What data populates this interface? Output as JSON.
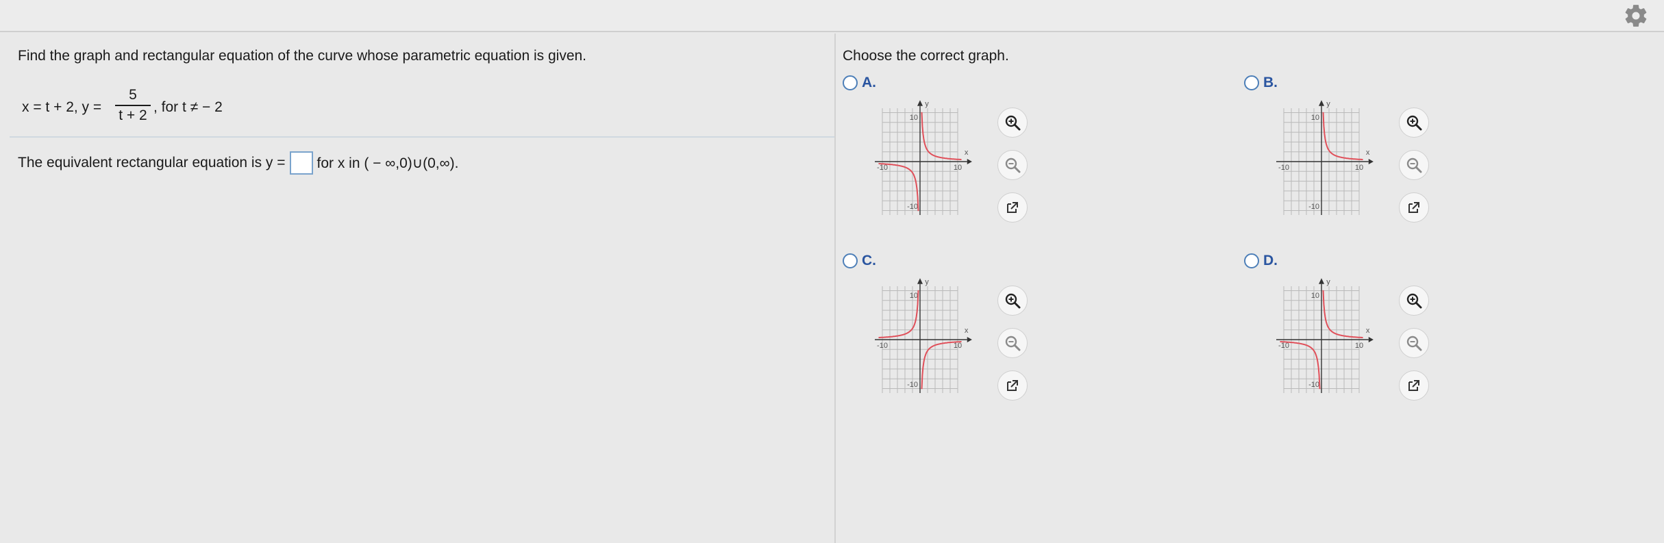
{
  "left": {
    "prompt": "Find the graph and rectangular equation of the curve whose parametric equation is given.",
    "param_x": "x = t + 2, y =",
    "frac_num": "5",
    "frac_den": "t + 2",
    "param_tail": ", for t ≠ − 2",
    "answer_prefix": "The equivalent rectangular equation is y =",
    "answer_value": "",
    "answer_suffix": "for x in ( − ∞,0)∪(0,∞)."
  },
  "right": {
    "choose": "Choose the correct graph.",
    "options": [
      {
        "label": "A.",
        "curve": "a"
      },
      {
        "label": "B.",
        "curve": "b"
      },
      {
        "label": "C.",
        "curve": "c"
      },
      {
        "label": "D.",
        "curve": "d"
      }
    ],
    "graph_ticks": {
      "top": "10",
      "bottom": "-10",
      "left": "-10",
      "right": "10",
      "xlabel": "x",
      "ylabel": "y"
    }
  },
  "colors": {
    "curve": "#e0505a",
    "radio_border": "#4d7fb8",
    "option_label": "#2a55a0",
    "grid": "#b9b9b9"
  },
  "icons": [
    "gear-icon",
    "zoom-in-icon",
    "zoom-out-icon",
    "open-external-icon"
  ]
}
